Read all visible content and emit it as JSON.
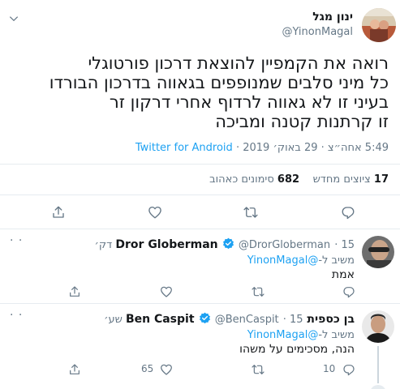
{
  "main_tweet": {
    "author_name": "ינון מגל",
    "author_handle": "@YinonMagal",
    "text_lines": [
      "רואה את הקמפיין להוצאת דרכון פורטוגלי",
      "כל מיני סלבים שמנופפים בגאווה בדרכון הבורדו",
      "בעיני זו לא גאווה לרדוף אחרי דרקון זר",
      "זו קרתנות קטנה ומביכה"
    ],
    "timestamp": "5:49 אחה״צ · 29 באוק׳ 2019 · ",
    "source": "Twitter for Android",
    "retweets_count": "17",
    "retweets_label": "ציוצים מחדש",
    "likes_count": "682",
    "likes_label": "סימונים כאהוב"
  },
  "replies": [
    {
      "author_name": "Dror Globerman",
      "author_handle": "@DrorGloberman",
      "time": "15 דק׳",
      "replying_to_label": "משיב ל-",
      "replying_to_handle": "@YinonMagal",
      "text": "אמת",
      "likes": "",
      "retweets": ""
    },
    {
      "author_name": "בן כספית Ben Caspit",
      "author_handle": "@BenCaspit",
      "time": "15 שע׳",
      "replying_to_label": "משיב ל-",
      "replying_to_handle": "@YinonMagal",
      "text": "הנה, מסכימים על משהו",
      "likes": "65",
      "retweets": "10"
    }
  ],
  "colors": {
    "accent": "#1da1f2",
    "verified": "#1da1f2",
    "muted": "#657786",
    "divider": "#e6ecf0"
  },
  "icons": [
    "chevron-down-icon",
    "reply-icon",
    "retweet-icon",
    "like-icon",
    "share-icon",
    "verified-badge-icon",
    "more-icon"
  ]
}
